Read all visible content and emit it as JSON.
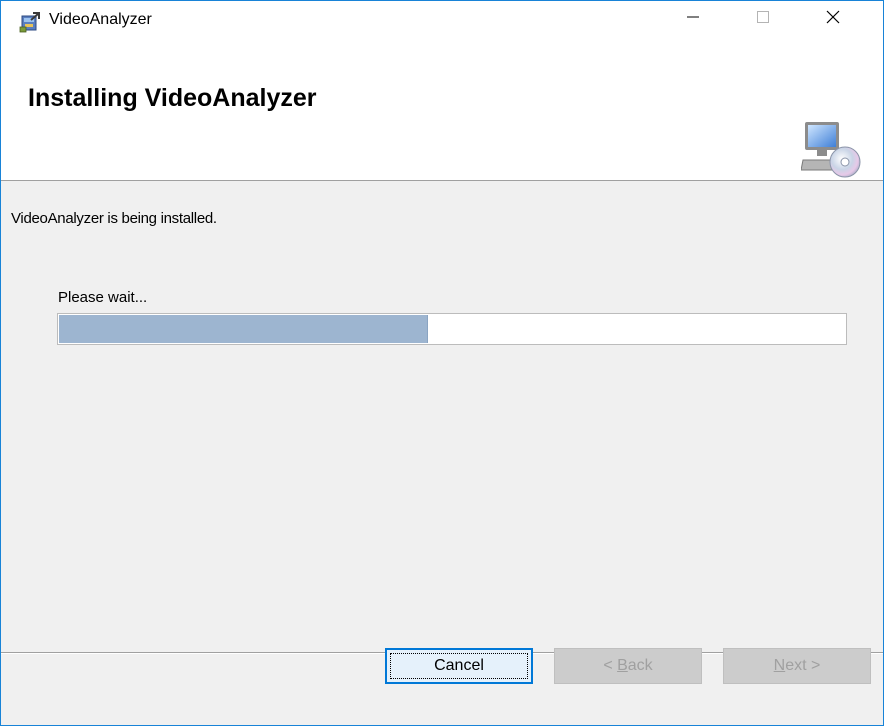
{
  "window": {
    "title": "VideoAnalyzer",
    "accent_color": "#1883d7",
    "icons": {
      "app": "installer-package-icon",
      "minimize": "minimize-icon",
      "maximize": "maximize-icon",
      "close": "close-icon"
    }
  },
  "header": {
    "heading": "Installing VideoAnalyzer",
    "icon": "computer-cd-icon"
  },
  "body": {
    "status": "VideoAnalyzer is being installed.",
    "progress_label": "Please wait...",
    "progress_percent": 47,
    "progress_color": "#9db5d0"
  },
  "footer": {
    "cancel_label": "Cancel",
    "back_prefix": "< ",
    "back_hotkey": "B",
    "back_rest": "ack",
    "next_hotkey": "N",
    "next_rest": "ext >"
  }
}
